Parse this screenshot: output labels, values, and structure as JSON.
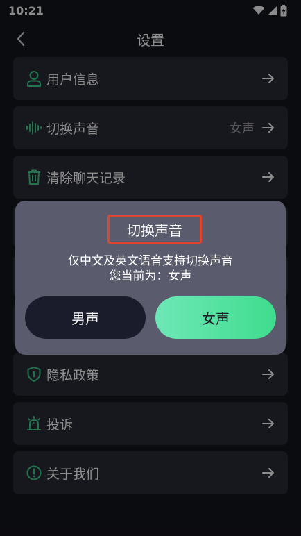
{
  "status_bar": {
    "time": "10:21"
  },
  "nav": {
    "title": "设置"
  },
  "menu": {
    "items": [
      {
        "label": "用户信息",
        "value": ""
      },
      {
        "label": "切换声音",
        "value": "女声"
      },
      {
        "label": "清除聊天记录",
        "value": ""
      },
      {
        "label": "",
        "value": ""
      },
      {
        "label": "",
        "value": ""
      },
      {
        "label": "",
        "value": ""
      },
      {
        "label": "隐私政策",
        "value": ""
      },
      {
        "label": "投诉",
        "value": ""
      },
      {
        "label": "关于我们",
        "value": ""
      }
    ]
  },
  "dialog": {
    "title": "切换声音",
    "message_line1": "仅中文及英文语音支持切换声音",
    "message_line2": "您当前为：女声",
    "male_label": "男声",
    "female_label": "女声"
  },
  "colors": {
    "background": "#15161d",
    "card": "#2b2c35",
    "dialog": "#5a5c6e",
    "accent_green": "#4ee49a",
    "icon_green": "#3fd18e",
    "highlight_red": "#e0452f"
  }
}
